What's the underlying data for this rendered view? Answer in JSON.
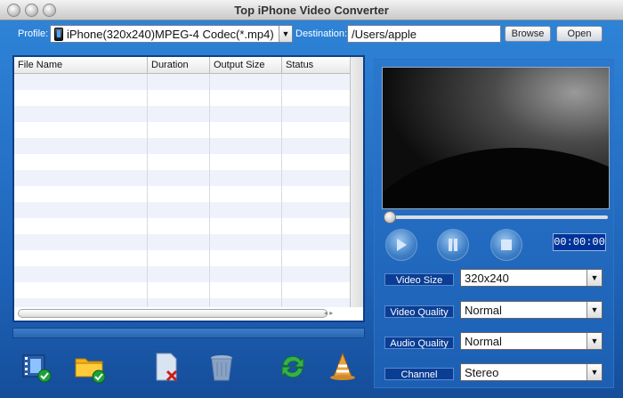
{
  "window": {
    "title": "Top iPhone Video Converter"
  },
  "profile": {
    "label": "Profile:",
    "value": "iPhone(320x240)MPEG-4 Codec(*.mp4)"
  },
  "destination": {
    "label": "Destination:",
    "value": "/Users/apple",
    "browse_label": "Browse",
    "open_label": "Open"
  },
  "file_table": {
    "columns": [
      "File Name",
      "Duration",
      "Output Size",
      "Status"
    ]
  },
  "player": {
    "time": "00:00:00"
  },
  "options": {
    "video_size": {
      "label": "Video Size",
      "value": "320x240"
    },
    "video_quality": {
      "label": "Video Quality",
      "value": "Normal"
    },
    "audio_quality": {
      "label": "Audio Quality",
      "value": "Normal"
    },
    "channel": {
      "label": "Channel",
      "value": "Stereo"
    }
  },
  "toolbar_icons": [
    "add-video-icon",
    "add-folder-icon",
    "remove-file-icon",
    "trash-icon",
    "convert-icon",
    "cone-icon"
  ]
}
